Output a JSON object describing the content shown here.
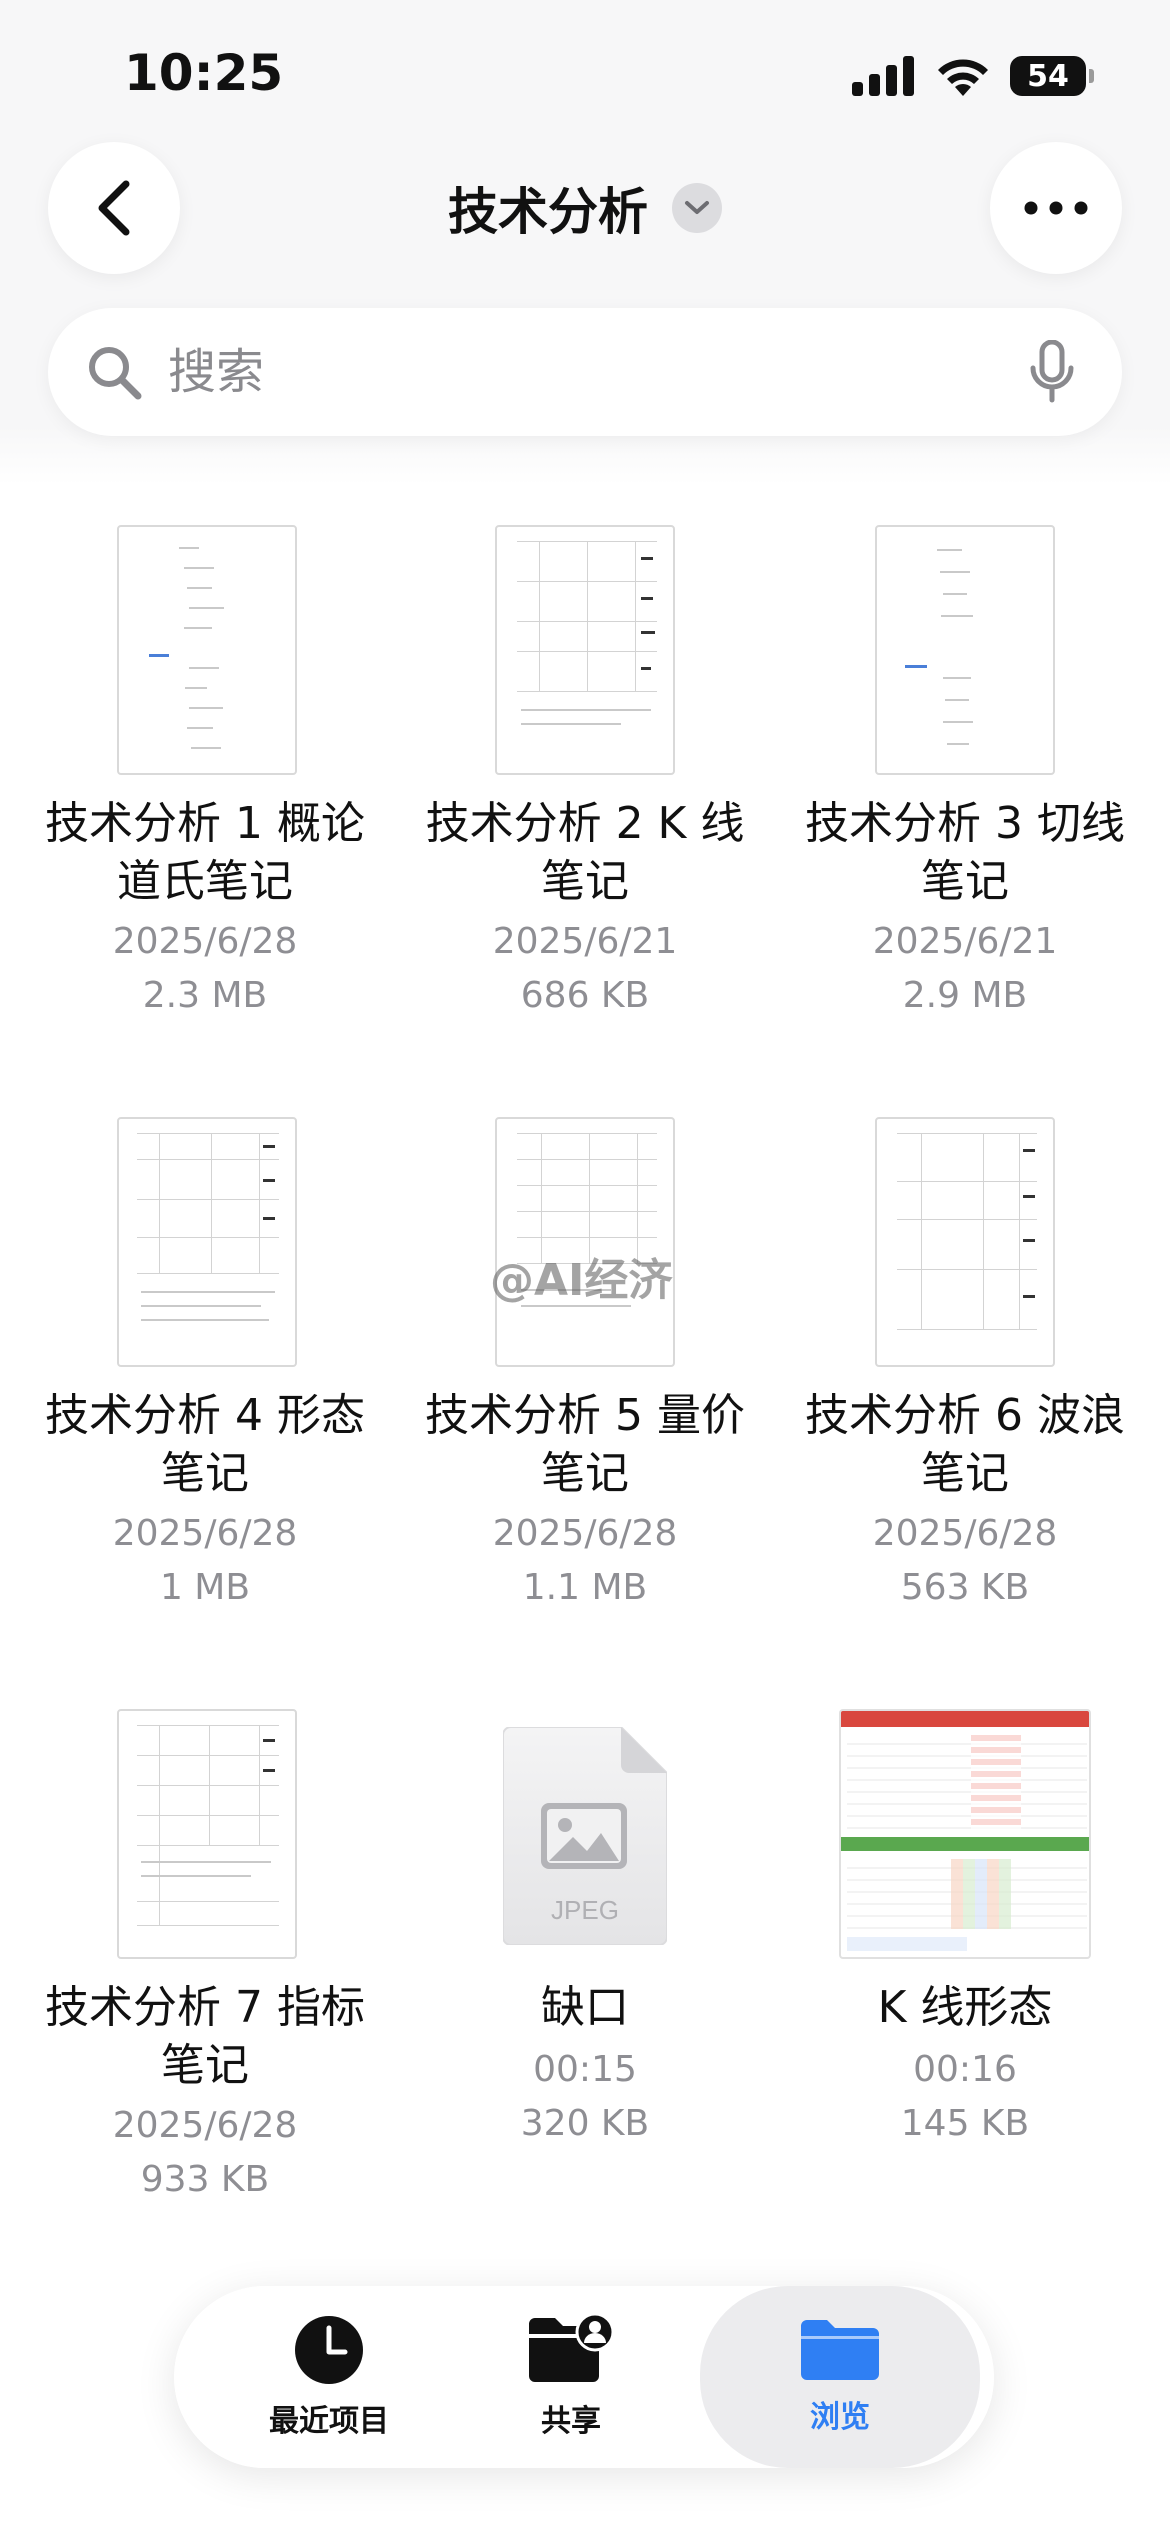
{
  "status_bar": {
    "time": "10:25",
    "battery": "54"
  },
  "header": {
    "title": "技术分析"
  },
  "search": {
    "placeholder": "搜索"
  },
  "files": [
    {
      "name_line1": "技术分析 1 概论",
      "name_line2": "道氏笔记",
      "date": "2025/6/28",
      "size": "2.3 MB"
    },
    {
      "name_line1": "技术分析 2 K 线",
      "name_line2": "笔记",
      "date": "2025/6/21",
      "size": "686 KB"
    },
    {
      "name_line1": "技术分析 3 切线",
      "name_line2": "笔记",
      "date": "2025/6/21",
      "size": "2.9 MB"
    },
    {
      "name_line1": "技术分析 4 形态",
      "name_line2": "笔记",
      "date": "2025/6/28",
      "size": "1 MB"
    },
    {
      "name_line1": "技术分析 5 量价",
      "name_line2": "笔记",
      "date": "2025/6/28",
      "size": "1.1 MB"
    },
    {
      "name_line1": "技术分析 6 波浪",
      "name_line2": "笔记",
      "date": "2025/6/28",
      "size": "563 KB"
    },
    {
      "name_line1": "技术分析 7 指标",
      "name_line2": "笔记",
      "date": "2025/6/28",
      "size": "933 KB"
    },
    {
      "name_line1": "缺口",
      "name_line2": "",
      "date": "00:15",
      "size": "320 KB",
      "badge": "JPEG"
    },
    {
      "name_line1": "K 线形态",
      "name_line2": "",
      "date": "00:16",
      "size": "145 KB"
    }
  ],
  "watermark": "@AI经济",
  "tabs": [
    {
      "label": "最近项目",
      "icon": "clock-icon"
    },
    {
      "label": "共享",
      "icon": "shared-folder-icon"
    },
    {
      "label": "浏览",
      "icon": "folder-icon",
      "active": true
    }
  ],
  "colors": {
    "accent": "#2f7ff3",
    "background": "#ffffff",
    "secondary_text": "#8e8e93"
  }
}
